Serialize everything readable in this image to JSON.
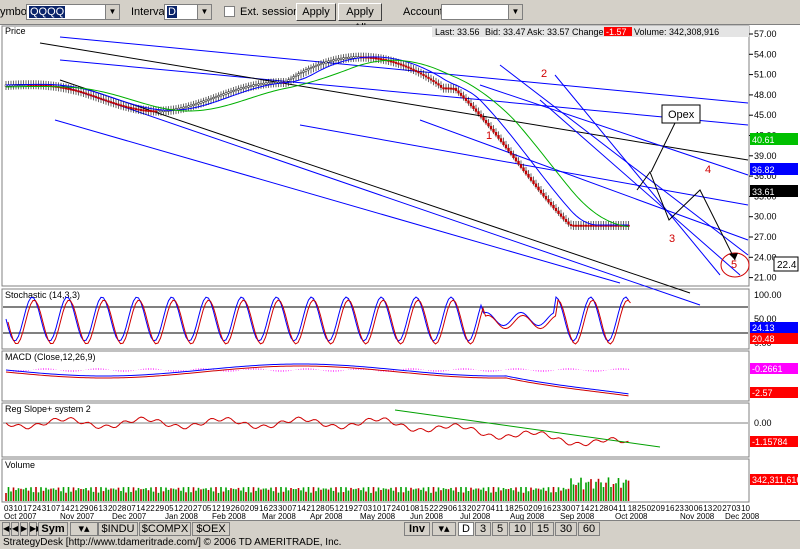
{
  "toolbar": {
    "symbol_label": "ymbol:",
    "symbol_value": "QQQQ",
    "interval_label": "Interval:",
    "interval_value": "D",
    "ext_session_label": "Ext. session",
    "apply_label": "Apply",
    "apply_all_label": "Apply All",
    "account_label": "Account:",
    "account_value": ""
  },
  "quote": {
    "last": "Last: 33.56",
    "bid": "Bid: 33.47",
    "ask": "Ask: 33.57",
    "change_label": "Change:",
    "change_value": "-1.57",
    "volume": "Volume: 342,308,916"
  },
  "panels": {
    "price_title": "Price",
    "stochastic_title": "Stochastic (14,3,3)",
    "macd_title": "MACD (Close,12,26,9)",
    "regslope_title": "Reg Slope+ system 2",
    "volume_title": "Volume"
  },
  "price_axis": [
    "57.00",
    "54.00",
    "51.00",
    "48.00",
    "45.00",
    "42.00",
    "39.00",
    "36.00",
    "33.00",
    "30.00",
    "27.00",
    "24.00",
    "21.00"
  ],
  "price_badges": {
    "green": "40.61",
    "blue": "36.82",
    "black": "33.61",
    "side": "22.4"
  },
  "stoch_axis": [
    "100.00",
    "50.00",
    "0.00"
  ],
  "stoch_badges": {
    "blue": "24.13",
    "red": "20.48"
  },
  "macd_badges": {
    "magenta": "-0.2661",
    "red": "-2.57"
  },
  "reg_axis": [
    "0.00"
  ],
  "reg_badges": {
    "red": "-1.15784"
  },
  "volume_badge": "342,311,616",
  "annotations": {
    "n1": "1",
    "n2": "2",
    "n3": "3",
    "n4": "4",
    "n5": "5",
    "opex": "Opex"
  },
  "dates": [
    "03",
    "10",
    "17",
    "24",
    "31",
    "07",
    "14",
    "21",
    "29",
    "06",
    "13",
    "20",
    "28",
    "07",
    "14",
    "22",
    "29",
    "05",
    "12",
    "20",
    "27",
    "05",
    "12",
    "19",
    "26",
    "02",
    "09",
    "16",
    "23",
    "30",
    "07",
    "14",
    "21",
    "28",
    "05",
    "12",
    "19",
    "27",
    "03",
    "10",
    "17",
    "24",
    "01",
    "08",
    "15",
    "22",
    "29",
    "06",
    "13",
    "20",
    "27",
    "04",
    "11",
    "18",
    "25",
    "02",
    "09",
    "16",
    "23",
    "30",
    "07",
    "14",
    "21",
    "28",
    "04",
    "11",
    "18",
    "25",
    "02",
    "09",
    "16",
    "23",
    "30",
    "06",
    "13",
    "20",
    "27",
    "03",
    "10"
  ],
  "months": [
    {
      "label": "Oct 2007"
    },
    {
      "label": "Nov 2007"
    },
    {
      "label": "Dec 2007"
    },
    {
      "label": "Jan 2008"
    },
    {
      "label": "Feb 2008"
    },
    {
      "label": "Mar 2008"
    },
    {
      "label": "Apr 2008"
    },
    {
      "label": "May 2008"
    },
    {
      "label": "Jun 2008"
    },
    {
      "label": "Jul 2008"
    },
    {
      "label": "Aug 2008"
    },
    {
      "label": "Sep 2008"
    },
    {
      "label": "Oct 2008"
    },
    {
      "label": "Nov 2008"
    },
    {
      "label": "Dec 2008"
    }
  ],
  "bottom_tabs": {
    "sym": "Sym",
    "symbols": [
      "$INDU",
      "$COMPX",
      "$OEX"
    ],
    "inv": "Inv",
    "intervals": [
      "D",
      "3",
      "5",
      "10",
      "15",
      "30",
      "60"
    ]
  },
  "status_text": "StrategyDesk [http://www.tdameritrade.com/] © 2006 TD AMERITRADE, Inc.",
  "colors": {
    "up": "#00a000",
    "down": "#d00000",
    "accent_blue": "#0000ff",
    "accent_green": "#00b000",
    "badge_magenta": "#ff00ff"
  }
}
